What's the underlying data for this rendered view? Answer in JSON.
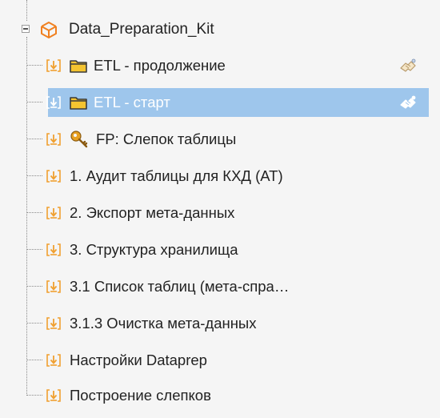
{
  "tree": {
    "root": {
      "label": "Data_Preparation_Kit",
      "icon": "package-icon"
    },
    "items": [
      {
        "label": "ETL - продолжение",
        "type": "folder",
        "shared": true,
        "selected": false
      },
      {
        "label": "ETL - старт",
        "type": "folder",
        "shared": true,
        "selected": true
      },
      {
        "label": "FP: Слепок таблицы",
        "type": "key",
        "shared": false,
        "selected": false
      },
      {
        "label": "1. Аудит таблицы для КХД (АТ)",
        "type": "task",
        "shared": false,
        "selected": false
      },
      {
        "label": "2. Экспорт мета-данных",
        "type": "task",
        "shared": false,
        "selected": false
      },
      {
        "label": "3. Структура хранилища",
        "type": "task",
        "shared": false,
        "selected": false
      },
      {
        "label": "3.1 Список таблиц (мета-спра…",
        "type": "task",
        "shared": false,
        "selected": false
      },
      {
        "label": "3.1.3 Очистка мета-данных",
        "type": "task",
        "shared": false,
        "selected": false
      },
      {
        "label": "Настройки Dataprep",
        "type": "task",
        "shared": false,
        "selected": false
      },
      {
        "label": "Построение слепков",
        "type": "task",
        "shared": false,
        "selected": false
      }
    ],
    "colors": {
      "selection": "#9ec6ec",
      "task_icon": "#f0a030",
      "folder": "#f4c430",
      "key": "#e8a020",
      "package": "#f08020"
    }
  }
}
